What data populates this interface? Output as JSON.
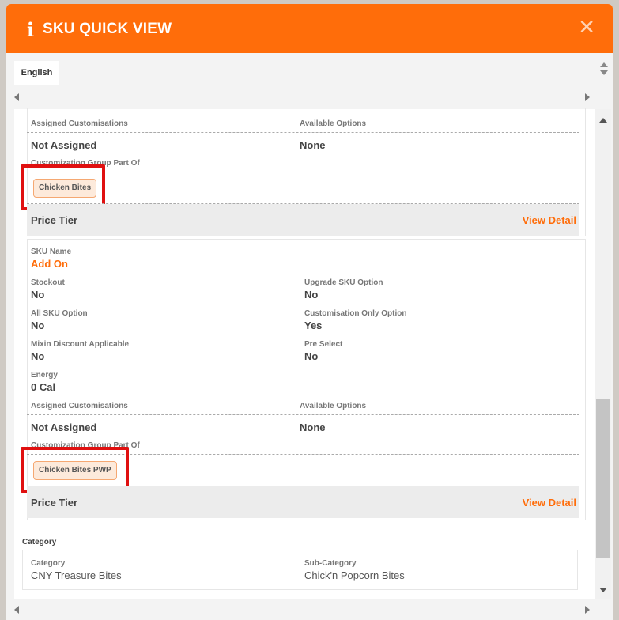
{
  "dialog": {
    "title": "SKU QUICK VIEW",
    "info_icon": "i",
    "close_icon": "✕"
  },
  "tabs": [
    {
      "label": "English"
    }
  ],
  "block1": {
    "assigned_customisations_label": "Assigned Customisations",
    "assigned_customisations_value": "Not Assigned",
    "available_options_label": "Available Options",
    "available_options_value": "None",
    "customization_group_label": "Customization Group Part Of",
    "chip": "Chicken Bites",
    "price_tier_label": "Price Tier",
    "view_detail": "View Detail"
  },
  "sku": {
    "name_label": "SKU Name",
    "name_value": "Add On",
    "stockout_label": "Stockout",
    "stockout_value": "No",
    "upgrade_label": "Upgrade SKU Option",
    "upgrade_value": "No",
    "all_sku_label": "All SKU Option",
    "all_sku_value": "No",
    "custom_only_label": "Customisation Only Option",
    "custom_only_value": "Yes",
    "mixin_label": "Mixin Discount Applicable",
    "mixin_value": "No",
    "preselect_label": "Pre Select",
    "preselect_value": "No",
    "energy_label": "Energy",
    "energy_value": "0 Cal",
    "assigned_customisations_label": "Assigned Customisations",
    "assigned_customisations_value": "Not Assigned",
    "available_options_label": "Available Options",
    "available_options_value": "None",
    "customization_group_label": "Customization Group Part Of",
    "chip": "Chicken Bites PWP",
    "price_tier_label": "Price Tier",
    "view_detail": "View Detail"
  },
  "category": {
    "section_label": "Category",
    "category_label": "Category",
    "category_value": "CNY Treasure Bites",
    "subcategory_label": "Sub-Category",
    "subcategory_value": "Chick'n Popcorn Bites"
  },
  "colors": {
    "accent": "#ff6d0a",
    "highlight": "#e01010"
  }
}
